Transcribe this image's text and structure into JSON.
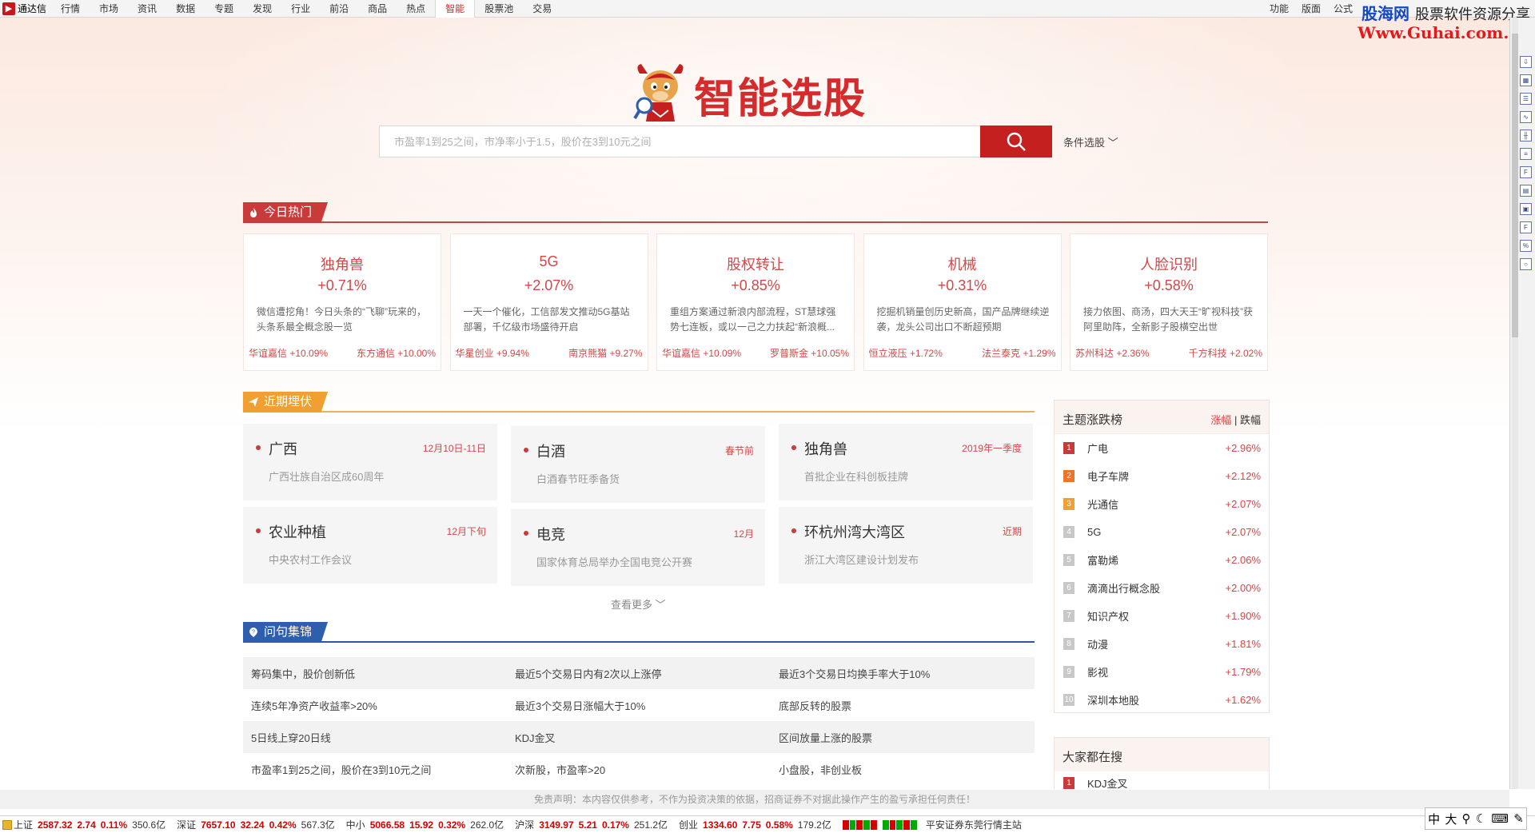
{
  "app": {
    "name": "通达信",
    "menu": [
      "行情",
      "市场",
      "资讯",
      "数据",
      "专题",
      "发现",
      "行业",
      "前沿",
      "商品",
      "热点",
      "智能",
      "股票池",
      "交易"
    ],
    "active_menu": "智能",
    "right_menu": [
      "功能",
      "版面",
      "公式"
    ]
  },
  "watermark": {
    "line1_brand": "股海网",
    "line1_text": "股票软件资源分享",
    "line2": "Www.Guhai.com.cn"
  },
  "header": {
    "title": "智能选股",
    "search_placeholder": "市盈率1到25之间，市净率小于1.5，股价在3到10元之间",
    "condition_label": "条件选股"
  },
  "hot": {
    "section_title": "今日热门",
    "cards": [
      {
        "name": "独角兽",
        "pct": "+0.71%",
        "desc": "微信遭挖角！今日头条的“飞聊”玩来的，头条系最全概念股一览",
        "s1": "华谊嘉信 +10.09%",
        "s2": "东方通信 +10.00%"
      },
      {
        "name": "5G",
        "pct": "+2.07%",
        "desc": "一天一个催化，工信部发文推动5G基站部署，千亿级市场盛待开启",
        "s1": "华星创业 +9.94%",
        "s2": "南京熊猫 +9.27%"
      },
      {
        "name": "股权转让",
        "pct": "+0.85%",
        "desc": "重组方案通过新浪内部流程，ST慧球强势七连板，或以一己之力扶起“新浪概...",
        "s1": "华谊嘉信 +10.09%",
        "s2": "罗普斯金 +10.05%"
      },
      {
        "name": "机械",
        "pct": "+0.31%",
        "desc": "挖掘机销量创历史新高，国产品牌继续逆袭，龙头公司出口不断超预期",
        "s1": "恒立液压 +1.72%",
        "s2": "法兰泰克 +1.29%"
      },
      {
        "name": "人脸识别",
        "pct": "+0.58%",
        "desc": "接力依图、商汤，四大天王“旷视科技”获阿里助阵，全新影子股横空出世",
        "s1": "苏州科达 +2.36%",
        "s2": "千方科技 +2.02%"
      }
    ]
  },
  "ambush": {
    "section_title": "近期埋伏",
    "items": [
      {
        "title": "广西",
        "date": "12月10日-11日",
        "sub": "广西壮族自治区成60周年"
      },
      {
        "title": "白酒",
        "date": "春节前",
        "sub": "白酒春节旺季备货"
      },
      {
        "title": "独角兽",
        "date": "2019年一季度",
        "sub": "首批企业在科创板挂牌"
      },
      {
        "title": "农业种植",
        "date": "12月下旬",
        "sub": "中央农村工作会议"
      },
      {
        "title": "电竞",
        "date": "12月",
        "sub": "国家体育总局举办全国电竞公开赛"
      },
      {
        "title": "环杭州湾大湾区",
        "date": "近期",
        "sub": "浙江大湾区建设计划发布"
      }
    ],
    "more_label": "查看更多"
  },
  "qa": {
    "section_title": "问句集锦",
    "rows": [
      [
        "筹码集中，股价创新低",
        "最近5个交易日内有2次以上涨停",
        "最近3个交易日均换手率大于10%"
      ],
      [
        "连续5年净资产收益率>20%",
        "最近3个交易日涨幅大于10%",
        "底部反转的股票"
      ],
      [
        "5日线上穿20日线",
        "KDJ金叉",
        "区间放量上涨的股票"
      ],
      [
        "市盈率1到25之间，股价在3到10元之间",
        "次新股，市盈率>20",
        "小盘股，非创业板"
      ]
    ]
  },
  "rank": {
    "title": "主题涨跌榜",
    "tab_up": "涨幅",
    "tab_sep": "|",
    "tab_down": "跌幅",
    "items": [
      {
        "n": "1",
        "label": "广电",
        "value": "+2.96%",
        "color": "#c93a3a"
      },
      {
        "n": "2",
        "label": "电子车牌",
        "value": "+2.12%",
        "color": "#e9762b"
      },
      {
        "n": "3",
        "label": "光通信",
        "value": "+2.07%",
        "color": "#f0a032"
      },
      {
        "n": "4",
        "label": "5G",
        "value": "+2.07%",
        "color": "#c8c8c8"
      },
      {
        "n": "5",
        "label": "富勒烯",
        "value": "+2.06%",
        "color": "#c8c8c8"
      },
      {
        "n": "6",
        "label": "滴滴出行概念股",
        "value": "+2.00%",
        "color": "#c8c8c8"
      },
      {
        "n": "7",
        "label": "知识产权",
        "value": "+1.90%",
        "color": "#c8c8c8"
      },
      {
        "n": "8",
        "label": "动漫",
        "value": "+1.81%",
        "color": "#c8c8c8"
      },
      {
        "n": "9",
        "label": "影视",
        "value": "+1.79%",
        "color": "#c8c8c8"
      },
      {
        "n": "10",
        "label": "深圳本地股",
        "value": "+1.62%",
        "color": "#c8c8c8"
      }
    ]
  },
  "everyone": {
    "title": "大家都在搜",
    "items": [
      {
        "n": "1",
        "label": "KDJ金叉"
      }
    ]
  },
  "disclaimer": "免责声明：本内容仅供参考，不作为投资决策的依据，招商证券不对据此操作产生的盈亏承担任何责任！",
  "status": {
    "indices": [
      {
        "name": "上证",
        "value": "2587.32",
        "chg": "2.74",
        "pct": "0.11%",
        "vol": "350.6亿"
      },
      {
        "name": "深证",
        "value": "7657.10",
        "chg": "32.24",
        "pct": "0.42%",
        "vol": "567.3亿"
      },
      {
        "name": "中小",
        "value": "5066.58",
        "chg": "15.92",
        "pct": "0.32%",
        "vol": "262.0亿"
      },
      {
        "name": "沪深",
        "value": "3149.97",
        "chg": "5.21",
        "pct": "0.17%",
        "vol": "251.2亿"
      },
      {
        "name": "创业",
        "value": "1334.60",
        "chg": "7.75",
        "pct": "0.58%",
        "vol": "179.2亿"
      }
    ],
    "broker": "平安证券东莞行情主站"
  },
  "ime": [
    "中",
    "大"
  ],
  "colors": {
    "accent": "#c4201f",
    "up": "#d24848",
    "blue": "#2d5fae",
    "orange": "#f0a032"
  }
}
